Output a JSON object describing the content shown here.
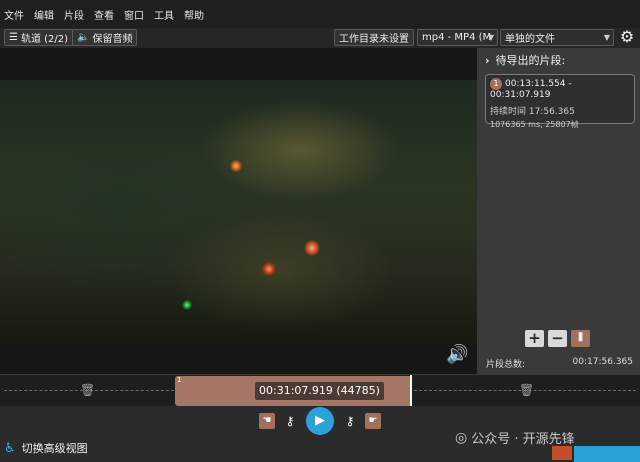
{
  "menu": [
    "文件",
    "编辑",
    "片段",
    "查看",
    "窗口",
    "工具",
    "帮助"
  ],
  "toolbar": {
    "tracks_label": "轨道 (2/2)",
    "keep_audio_label": "保留音频",
    "workdir_label": "工作目录未设置",
    "format_value": "mp4 - MP4 (M",
    "output_mode_value": "单独的文件"
  },
  "panel": {
    "title": "待导出的片段:",
    "segment": {
      "index": "1",
      "range": "00:13:11.554 - 00:31:07.919",
      "duration": "持续时间 17:56.365",
      "details": "1076365 ms, 25807帧"
    },
    "total_label": "片段总数:",
    "total_value": "00:17:56.365"
  },
  "timeline": {
    "segment_index": "1",
    "time_display": "00:31:07.919 (44785)"
  },
  "bottom": {
    "advanced_view_label": "切换高级视图",
    "watermark_text": "公众号 · 开源先锋"
  },
  "colors": {
    "segment": "#a47663",
    "accent": "#2aa2d8"
  }
}
